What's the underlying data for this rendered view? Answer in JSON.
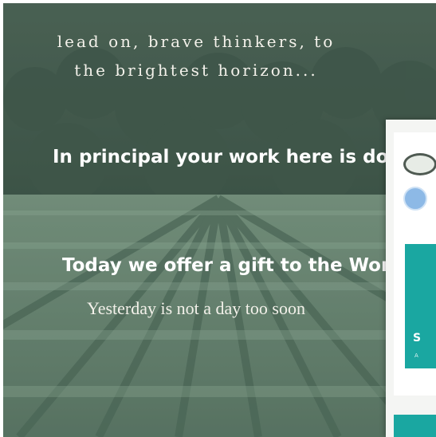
{
  "hero": {
    "tagline_line1": "lead on, brave thinkers, to",
    "tagline_line2": "the brightest horizon...",
    "headline_1": "In principal your work here is done",
    "headline_2": "Today we offer a gift to the World",
    "subline": "Yesterday is not a day too soon"
  },
  "side_panel": {
    "card_letter": "S",
    "card_caption": "A"
  },
  "colors": {
    "accent_teal": "#1aa7a1",
    "overlay_text": "#f3f1ea"
  }
}
